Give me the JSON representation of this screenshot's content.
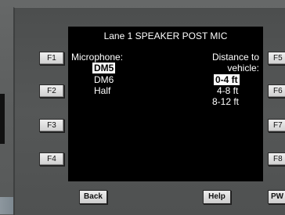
{
  "screen": {
    "title": "Lane 1 SPEAKER POST MIC",
    "microphone_label": "Microphone:",
    "microphone_options": [
      "DM5",
      "DM6",
      "Half"
    ],
    "distance_label_line1": "Distance to",
    "distance_label_line2": "vehicle:",
    "distance_options": [
      "0-4 ft",
      "4-8 ft",
      "8-12 ft"
    ]
  },
  "left_keys": [
    "F1",
    "F2",
    "F3",
    "F4"
  ],
  "right_keys": [
    "F5",
    "F6",
    "F7",
    "F8"
  ],
  "bottom_keys": {
    "back": "Back",
    "help": "Help",
    "power": "PW"
  },
  "colors": {
    "screen_bg": "#000000",
    "screen_text": "#ffffff",
    "bezel": "#555757",
    "key_face": "#e0e0e0"
  }
}
